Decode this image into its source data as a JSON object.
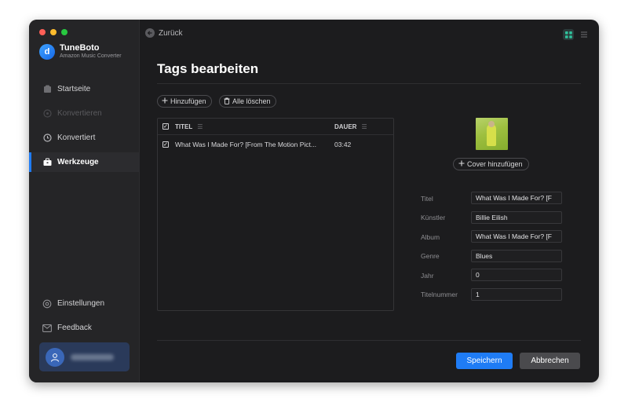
{
  "app": {
    "name": "TuneBoto",
    "subtitle": "Amazon Music Converter",
    "logo_letter": "d"
  },
  "sidebar": {
    "items": [
      {
        "label": "Startseite",
        "icon": "home-icon",
        "state": "normal"
      },
      {
        "label": "Konvertieren",
        "icon": "convert-icon",
        "state": "disabled"
      },
      {
        "label": "Konvertiert",
        "icon": "clock-icon",
        "state": "normal"
      },
      {
        "label": "Werkzeuge",
        "icon": "toolbox-icon",
        "state": "active"
      }
    ],
    "bottom_items": [
      {
        "label": "Einstellungen",
        "icon": "gear-icon"
      },
      {
        "label": "Feedback",
        "icon": "mail-icon"
      }
    ]
  },
  "topbar": {
    "back_label": "Zurück"
  },
  "page": {
    "title": "Tags bearbeiten"
  },
  "toolbar": {
    "add_label": "Hinzufügen",
    "clear_label": "Alle löschen"
  },
  "table": {
    "columns": {
      "title": "TITEL",
      "duration": "DAUER"
    },
    "rows": [
      {
        "title": "What Was I Made For? [From The Motion Pict...",
        "duration": "03:42",
        "checked": true
      }
    ]
  },
  "cover": {
    "add_label": "Cover hinzufügen"
  },
  "form": {
    "fields": [
      {
        "label": "Titel",
        "value": "What Was I Made For? [F"
      },
      {
        "label": "Künstler",
        "value": "Billie Eilish"
      },
      {
        "label": "Album",
        "value": "What Was I Made For? [F"
      },
      {
        "label": "Genre",
        "value": "Blues"
      },
      {
        "label": "Jahr",
        "value": "0"
      },
      {
        "label": "Titelnummer",
        "value": "1"
      }
    ]
  },
  "actions": {
    "save_label": "Speichern",
    "cancel_label": "Abbrechen"
  },
  "colors": {
    "accent": "#1f7cf5",
    "background": "#1c1c1e",
    "sidebar": "#252527"
  }
}
